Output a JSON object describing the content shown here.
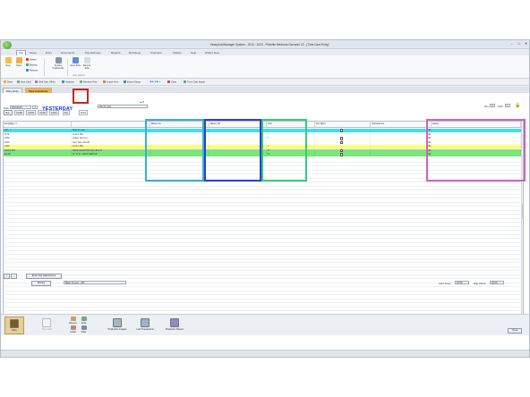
{
  "window": {
    "title": "HeavyJob/Manager System - 2010 - 1023 - Pickville Medrona Giovanni LS - [Time Card Entry]",
    "minimize": "–",
    "maximize": "□",
    "close": "✕"
  },
  "menu": [
    "File",
    "Setup",
    "Entry",
    "Documents",
    "Pay Estimate",
    "Reports",
    "Exchange",
    "Overview",
    "Utilities",
    "Help",
    "What's New"
  ],
  "ribbon": {
    "new_label": "New",
    "open_label": "Open",
    "delete_label": "Delete",
    "backup_label": "Backup",
    "restore_label": "Restore",
    "system_passwords_label": "System Passwords",
    "user_label": "User Jobs",
    "recent_jobs_label": "Recent Jobs",
    "group_user_options": "User Options"
  },
  "toolbar": [
    "Diary",
    "New Card",
    "Shift Calc Offset",
    "Analysis",
    "Retrieve Prev",
    "Import from",
    "Export Setup",
    "Clear",
    "Time Card Import"
  ],
  "doc_tabs": [
    "Diary Entry",
    "Time Card Entry"
  ],
  "form": {
    "date_label": "Date",
    "date_value": "6/10/2019",
    "day_text": "YESTERDAY",
    "foreman_value": "Van D Luce",
    "rev_label": "Rev",
    "rev_value": "0",
    "shift_label": "Shift",
    "shift_value": "1",
    "extra_label": "Extra"
  },
  "section_tabs": [
    "Main",
    "AAAB",
    "AAAR",
    "AAAR",
    "AAAA",
    "Extra"
  ],
  "columns": {
    "emp": "Emp/Eqp ><",
    "desc": "",
    "meter_on": "Meter On",
    "meter_off": "Meter Off",
    "unit": "Unit",
    "per_diem": "Per Diem",
    "subsistence": "Subsistence",
    "notes": "Notes"
  },
  "rows": [
    {
      "code": "267",
      "desc": "Brian D Luce",
      "unit": "",
      "sub": "$0",
      "perdiem": true,
      "color": "#40e0f0"
    },
    {
      "code": "1178",
      "desc": "Ford F-350",
      "unit": "",
      "sub": "$0",
      "perdiem": false,
      "color": "#ffffff"
    },
    {
      "code": "2339",
      "desc": "Avalyn Van Cox",
      "unit": "Y",
      "sub": "$0",
      "perdiem": true,
      "color": "#ffffff"
    },
    {
      "code": "1823",
      "desc": "Larry Allen Arnold",
      "unit": "",
      "sub": "$0",
      "perdiem": true,
      "color": "#ffffff"
    },
    {
      "code": "1240",
      "desc": "Ford F-350",
      "unit": "Y",
      "sub": "$0",
      "perdiem": false,
      "color": "#ffff70"
    },
    {
      "code": "R1403-003",
      "desc": "305 EXCAVATOR CRC 3E 374",
      "unit": "N",
      "sub": "$0",
      "perdiem": true,
      "color": "#7de57a"
    },
    {
      "code": "EX-09",
      "desc": "IS \"LT\"E\" 114HC 4060 LB",
      "unit": "N",
      "sub": "$0",
      "perdiem": true,
      "color": "#7de57a"
    }
  ],
  "bottom": {
    "add": "+",
    "remove": "–",
    "enter_pay_adjustments": "Enter Pay Adjustments",
    "review_label": "Review",
    "review_value": "Brian D Luce - 267",
    "lab_hours_label": "Lab Hours:",
    "lab_hours_value": "24:00",
    "eqp_hours_label": "Eqp Hours:",
    "eqp_hours_value": "32:00"
  },
  "launcher": {
    "diary": "Diary",
    "time_card": "Time Card",
    "receive": "Receive",
    "subs": "Subs",
    "install": "Install",
    "other": "Other",
    "production_analysis": "Production Analysis",
    "lock_transactions": "Lock Transactions",
    "production_planner": "Production Planner",
    "close": "Close"
  },
  "highlight_colors": {
    "extra": "#c0281e",
    "meter_on": "#36aee0",
    "meter_off": "#2f3fd0",
    "unit": "#2ecf7a",
    "notes": "#d55fc0"
  }
}
